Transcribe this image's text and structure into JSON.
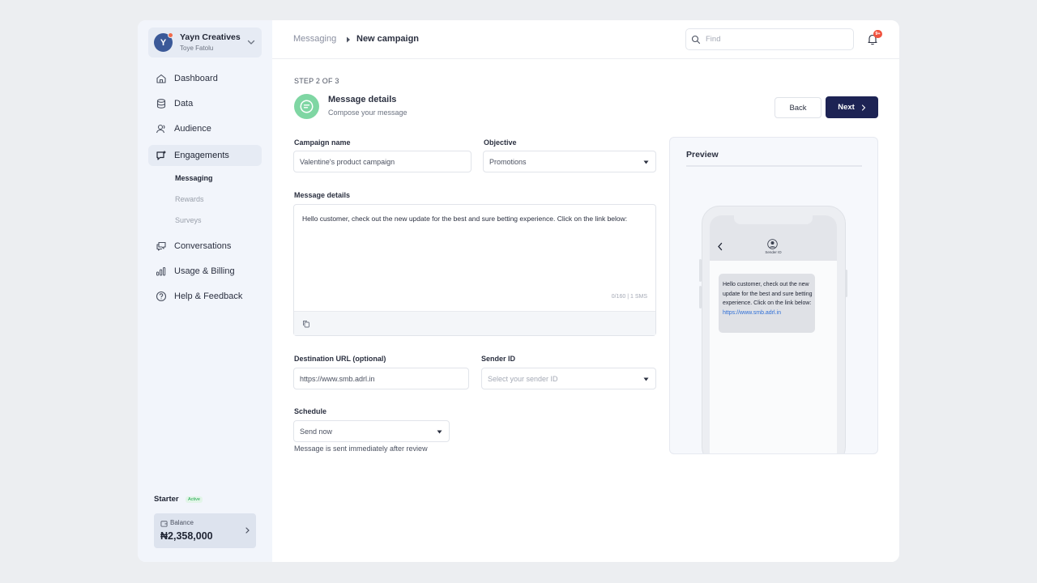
{
  "account": {
    "initial": "Y",
    "name": "Yayn Creatives",
    "user": "Toye Fatolu"
  },
  "sidebar": {
    "items": [
      {
        "label": "Dashboard",
        "icon": "home-icon"
      },
      {
        "label": "Data",
        "icon": "database-icon"
      },
      {
        "label": "Audience",
        "icon": "users-icon"
      },
      {
        "label": "Engagements",
        "icon": "chat-icon"
      },
      {
        "label": "Conversations",
        "icon": "conversations-icon"
      },
      {
        "label": "Usage & Billing",
        "icon": "bar-chart-icon"
      },
      {
        "label": "Help & Feedback",
        "icon": "help-icon"
      }
    ],
    "subitems": [
      "Messaging",
      "Rewards",
      "Surveys"
    ],
    "active_subitem": "Messaging"
  },
  "plan": {
    "name": "Starter",
    "status": "Active",
    "balance_label": "Balance",
    "balance_value": "₦2,358,000"
  },
  "breadcrumb": {
    "parent": "Messaging",
    "current": "New campaign"
  },
  "search": {
    "placeholder": "Find"
  },
  "notifications": {
    "count": "9+"
  },
  "step": {
    "indicator": "STEP 2 OF 3",
    "title": "Message details",
    "subtitle": "Compose your message"
  },
  "actions": {
    "back": "Back",
    "next": "Next"
  },
  "form": {
    "campaign_name_label": "Campaign name",
    "campaign_name_value": "Valentine's product campaign",
    "objective_label": "Objective",
    "objective_value": "Promotions",
    "message_label": "Message details",
    "message_value": "Hello customer, check out the new update for the best and sure betting experience. Click on the link below:",
    "counter": "0/160 | 1 SMS",
    "destination_label": "Destination URL (optional)",
    "destination_value": "https://www.smb.adrl.in",
    "sender_label": "Sender ID",
    "sender_placeholder": "Select your sender ID",
    "schedule_label": "Schedule",
    "schedule_value": "Send now",
    "schedule_hint": "Message is sent immediately after review"
  },
  "preview": {
    "title": "Preview",
    "sender": "Sender ID",
    "message": "Hello customer, check out the new update for the best and sure betting experience. Click on the link below:",
    "link": "https://www.smb.adrl.in"
  },
  "colors": {
    "primary": "#1d2354",
    "accent_green": "#7fd6a3",
    "badge_red": "#f0523e",
    "link_blue": "#2f6fd6"
  }
}
